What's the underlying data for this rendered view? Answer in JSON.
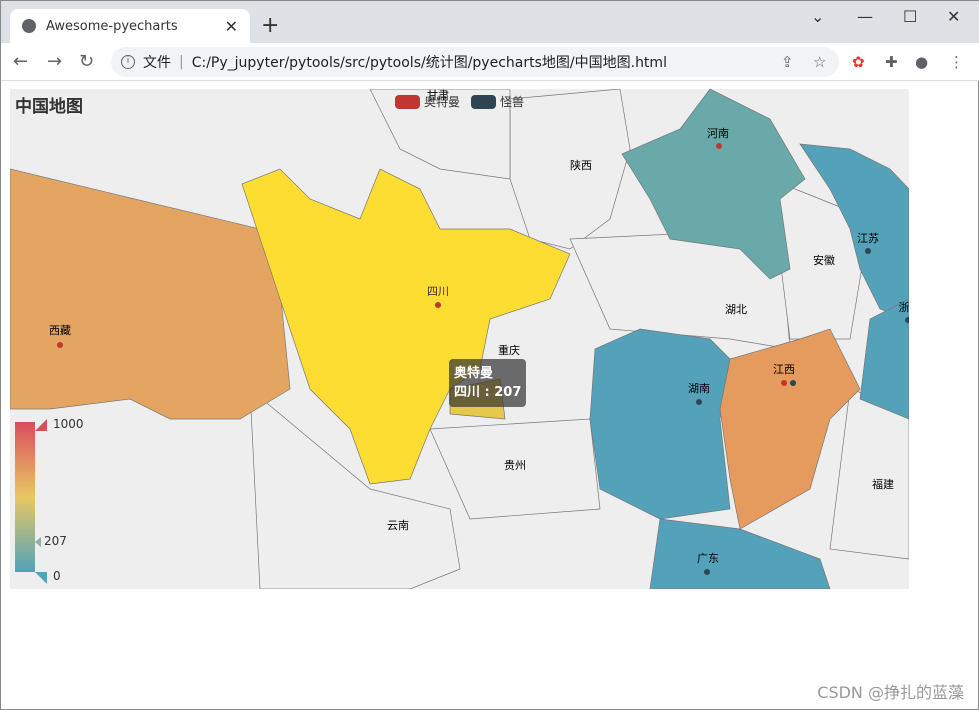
{
  "browser": {
    "tab_title": "Awesome-pyecharts",
    "address_prefix": "文件",
    "url": "C:/Py_jupyter/pytools/src/pytools/统计图/pyecharts地图/中国地图.html"
  },
  "chart": {
    "title": "中国地图",
    "legend": [
      {
        "name": "奥特曼",
        "color": "#c23531"
      },
      {
        "name": "怪兽",
        "color": "#2f4554"
      }
    ],
    "visual_map": {
      "max": "1000",
      "min": "0",
      "current": "207",
      "colors": [
        "#50a3ba",
        "#eac763",
        "#d94e5d"
      ]
    },
    "provinces": [
      "甘肃",
      "陕西",
      "河南",
      "江苏",
      "安徽",
      "湖北",
      "浙",
      "四川",
      "西藏",
      "重庆",
      "湖南",
      "江西",
      "贵州",
      "福建",
      "云南",
      "广东"
    ],
    "tooltip": {
      "series": "奥特曼",
      "text": "四川 : 207"
    }
  },
  "watermark": "CSDN @挣扎的蓝藻"
}
